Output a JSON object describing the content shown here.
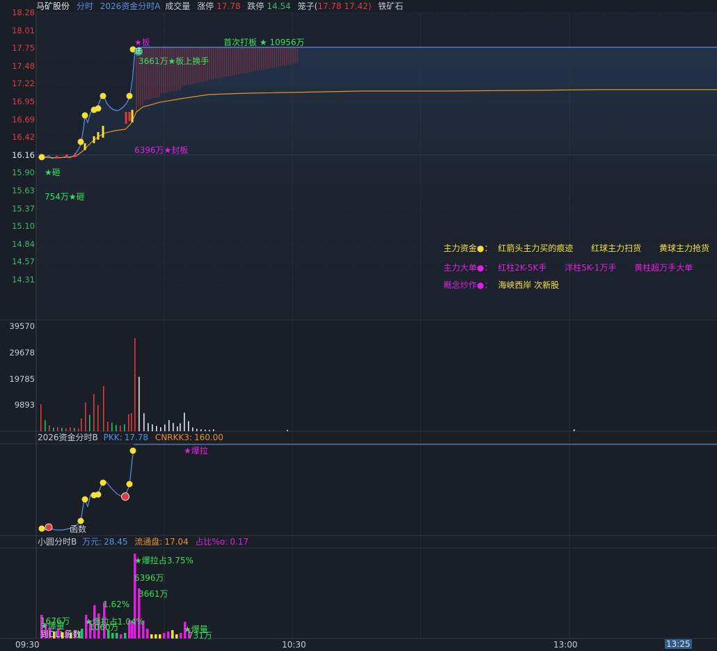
{
  "header": {
    "stock_name": "马矿股份",
    "mode": "分时",
    "indicator": "2026资金分时A",
    "volume_label": "成交量",
    "limit_up_label": "涨停",
    "limit_up_value": "17.78",
    "limit_down_label": "跌停",
    "limit_down_value": "14.54",
    "cage_label": "笼子(",
    "cage_value": "17.78 17.42)",
    "concept": "铁矿石"
  },
  "price_axis": [
    "18.28",
    "18.01",
    "17.75",
    "17.48",
    "17.22",
    "16.95",
    "16.69",
    "16.42",
    "16.16",
    "15.90",
    "15.63",
    "15.37",
    "15.10",
    "14.84",
    "14.57",
    "14.31"
  ],
  "volume_axis": [
    "39570",
    "29678",
    "19785",
    "9893"
  ],
  "annotations": {
    "board": "★板",
    "first_board": "首次打板 ★ 10956万",
    "turnover": "3661万★板上换手",
    "seal": "6396万★封板",
    "smash": "★砸",
    "smash_amount": "754万★砸",
    "ban_icon": "庄"
  },
  "legend": {
    "row1_title": "主力资金●：",
    "row1_items": [
      "红箭头主力买的痕迹",
      "红球主力扫货",
      "黄球主力抢货"
    ],
    "row2_title": "主力大单●：",
    "row2_items": [
      "红柱2K-5K手",
      "洋柱5K-1万手",
      "黄柱超万手大单"
    ],
    "row3_title": "概念炒作●：",
    "row3_value": "海峡西岸 次新股"
  },
  "panel_b": {
    "title": "2026资金分时B",
    "pkk_label": "PKK:",
    "pkk_value": "17.78",
    "cnrkk_label": "CNRKK3:",
    "cnrkk_value": "160.00",
    "burst": "★爆拉",
    "func_label": "函数"
  },
  "panel_c": {
    "title": "小圆分时B",
    "wan_label": "万元:",
    "wan_value": "28.45",
    "float_label": "流通盘:",
    "float_value": "17.04",
    "ratio_label": "占比%o:",
    "ratio_value": "0.17",
    "burst_ratio": "★爆拉占3.75%",
    "amt1": "6396万",
    "amt2": "3661万",
    "pct1": "1.62%",
    "amt3": "1676万",
    "burst_vol": "★爆量",
    "burst_ratio2": "★爆拉占1.04%",
    "amt4": "1060万",
    "func_label": "到DLL函数",
    "burst_vol2": "★爆量",
    "amt5": "731万"
  },
  "time_axis": [
    "09:30",
    "10:30",
    "13:00",
    "13:25"
  ],
  "colors": {
    "up": "#e03c3c",
    "down": "#2fbf6a",
    "price_line": "#5b8fe8",
    "avg_line": "#e8912f",
    "yellow": "#f5e03a",
    "magenta": "#e020e0",
    "green_text": "#3ae05a"
  }
}
